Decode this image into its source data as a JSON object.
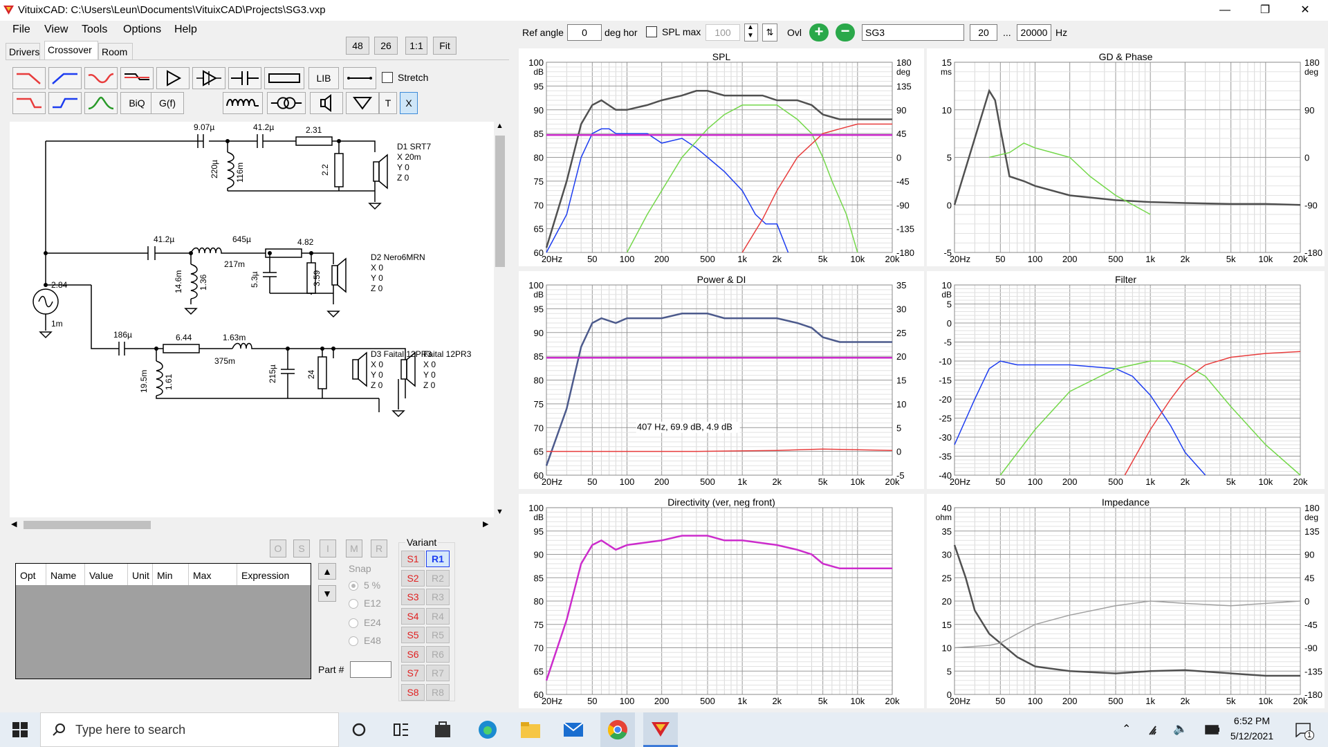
{
  "window": {
    "title": "VituixCAD: C:\\Users\\Leun\\Documents\\VituixCAD\\Projects\\SG3.vxp",
    "minimize": "—",
    "restore": "❐",
    "close": "✕"
  },
  "menu": [
    "File",
    "View",
    "Tools",
    "Options",
    "Help"
  ],
  "tabs": [
    "Drivers",
    "Crossover",
    "Room"
  ],
  "zoom_buttons": [
    "48",
    "26",
    "1:1",
    "Fit"
  ],
  "toolbar": {
    "lib": "LIB",
    "biq": "BiQ",
    "gf": "G(f)",
    "t": "T",
    "x": "X",
    "stretch": "Stretch"
  },
  "topbar": {
    "ref_angle_label": "Ref angle",
    "ref_angle_value": "0",
    "deg_hor": "deg hor",
    "spl_max_label": "SPL max",
    "spl_max_value": "100",
    "ovl": "Ovl",
    "ovl_name": "SG3",
    "f_low": "20",
    "ellipsis": "...",
    "f_high": "20000",
    "hz": "Hz"
  },
  "schematic": {
    "d1": [
      "D1 SRT7",
      "X 20m",
      "Y 0",
      "Z 0"
    ],
    "d2": [
      "D2 Nero6MRN",
      "X 0",
      "Y 0",
      "Z 0"
    ],
    "d3": [
      "D3 Faital 12PR3",
      "X 0",
      "Y 0",
      "Z 0"
    ],
    "d4": [
      "Faital 12PR3",
      "X 0",
      "Y 0",
      "Z 0"
    ],
    "values": {
      "c1": "9.07µ",
      "c2": "41.2µ",
      "r1": "2.31",
      "l1": "220µ",
      "r1s": "116m",
      "r2": "2.2",
      "c3": "41.2µ",
      "l2": "645µ",
      "l2r": "217m",
      "r3": "4.82",
      "l3": "14.6m",
      "l3r": "1.36",
      "c4": "5.3µ",
      "r4": "3.59",
      "src": "2.84",
      "srcr": "1m",
      "c5": "186µ",
      "r5": "6.44",
      "l4": "1.63m",
      "l4r": "375m",
      "l5": "19.5m",
      "l5r": "1.61",
      "c6": "215µ",
      "r6": "24"
    }
  },
  "param_grid": {
    "headers": [
      "Opt",
      "Name",
      "Value",
      "Unit",
      "Min",
      "Max",
      "Expression"
    ]
  },
  "param_buttons": [
    "O",
    "S",
    "I",
    "M",
    "R"
  ],
  "snap": {
    "label": "Snap",
    "options": [
      "5 %",
      "E12",
      "E24",
      "E48"
    ]
  },
  "part_label": "Part #",
  "variant": {
    "label": "Variant",
    "s": [
      "S1",
      "S2",
      "S3",
      "S4",
      "S5",
      "S6",
      "S7",
      "S8"
    ],
    "r": [
      "R1",
      "R2",
      "R3",
      "R4",
      "R5",
      "R6",
      "R7",
      "R8"
    ]
  },
  "colors": {
    "blue": "#1c3cf0",
    "green": "#74d84a",
    "red": "#e83c3c",
    "dark": "#505050",
    "gray": "#a0a0a0",
    "magenta": "#cc2ccc",
    "navy": "#4c5a8c"
  },
  "freq_ticks": [
    "20Hz",
    "50",
    "100",
    "200",
    "500",
    "1k",
    "2k",
    "5k",
    "10k",
    "20k"
  ],
  "charts": {
    "spl": {
      "title": "SPL",
      "yunit": "dB",
      "yunit2": "deg",
      "yticks": [
        "100",
        "95",
        "90",
        "85",
        "80",
        "75",
        "70",
        "65",
        "60"
      ],
      "y2ticks": [
        "180",
        "135",
        "90",
        "45",
        "0",
        "-45",
        "-90",
        "-135",
        "-180"
      ]
    },
    "gd": {
      "title": "GD & Phase",
      "yunit": "ms",
      "yunit2": "deg",
      "yticks": [
        "15",
        "10",
        "5",
        "0",
        "-5"
      ],
      "y2ticks": [
        "180",
        "90",
        "0",
        "-90",
        "-180"
      ]
    },
    "power": {
      "title": "Power & DI",
      "yunit": "dB",
      "yticks": [
        "100",
        "95",
        "90",
        "85",
        "80",
        "75",
        "70",
        "65",
        "60"
      ],
      "y2ticks": [
        "35",
        "30",
        "25",
        "20",
        "15",
        "10",
        "5",
        "0",
        "-5"
      ],
      "readout": "407 Hz, 69.9 dB, 4.9 dB"
    },
    "filter": {
      "title": "Filter",
      "yunit": "dB",
      "yticks": [
        "10",
        "5",
        "0",
        "-5",
        "-10",
        "-15",
        "-20",
        "-25",
        "-30",
        "-35",
        "-40"
      ]
    },
    "directivity": {
      "title": "Directivity (ver, neg front)",
      "yunit": "dB",
      "yticks": [
        "100",
        "95",
        "90",
        "85",
        "80",
        "75",
        "70",
        "65",
        "60"
      ]
    },
    "impedance": {
      "title": "Impedance",
      "yunit": "ohm",
      "yunit2": "deg",
      "yticks": [
        "40",
        "35",
        "30",
        "25",
        "20",
        "15",
        "10",
        "5",
        "0"
      ],
      "y2ticks": [
        "180",
        "135",
        "90",
        "45",
        "0",
        "-45",
        "-90",
        "-135",
        "-180"
      ]
    }
  },
  "chart_data": [
    {
      "type": "line",
      "title": "SPL",
      "xscale": "log",
      "xlim": [
        20,
        20000
      ],
      "ylim": [
        60,
        100
      ],
      "series": [
        {
          "color": "#505050",
          "x": [
            20,
            30,
            40,
            50,
            60,
            80,
            100,
            150,
            200,
            300,
            400,
            500,
            700,
            1000,
            1500,
            2000,
            3000,
            4000,
            5000,
            7000,
            10000,
            15000,
            20000
          ],
          "y": [
            61,
            75,
            87,
            91,
            92,
            90,
            90,
            91,
            92,
            93,
            94,
            94,
            93,
            93,
            93,
            92,
            92,
            91,
            89,
            88,
            88,
            88,
            88
          ]
        },
        {
          "color": "#1c3cf0",
          "x": [
            20,
            30,
            40,
            50,
            60,
            70,
            80,
            100,
            150,
            200,
            300,
            400,
            500,
            700,
            1000,
            1300,
            1600,
            2000,
            2500
          ],
          "y": [
            60,
            68,
            80,
            85,
            86,
            86,
            85,
            85,
            85,
            83,
            84,
            82,
            80,
            77,
            73,
            68,
            66,
            66,
            60
          ]
        },
        {
          "color": "#74d84a",
          "x": [
            100,
            150,
            200,
            300,
            500,
            700,
            1000,
            1500,
            2000,
            3000,
            4000,
            5000,
            6000,
            8000,
            10000
          ],
          "y": [
            60,
            68,
            73,
            80,
            86,
            89,
            91,
            91,
            91,
            88,
            85,
            80,
            75,
            68,
            60
          ]
        },
        {
          "color": "#e83c3c",
          "x": [
            1000,
            1500,
            2000,
            3000,
            5000,
            7000,
            10000,
            15000,
            20000
          ],
          "y": [
            60,
            67,
            73,
            80,
            85,
            86,
            87,
            87,
            87
          ]
        },
        {
          "color": "#cc2ccc",
          "x": [
            20,
            20000
          ],
          "y": [
            84.7,
            84.7
          ]
        }
      ]
    },
    {
      "type": "line",
      "title": "GD & Phase",
      "xscale": "log",
      "xlim": [
        20,
        20000
      ],
      "ylim": [
        -5,
        15
      ],
      "series": [
        {
          "color": "#505050",
          "x": [
            20,
            30,
            40,
            45,
            50,
            60,
            80,
            100,
            200,
            500,
            1000,
            2000,
            5000,
            10000,
            20000
          ],
          "y": [
            0,
            7,
            12,
            11,
            8,
            3,
            2.5,
            2,
            1,
            0.5,
            0.3,
            0.2,
            0.1,
            0.1,
            0
          ]
        },
        {
          "color": "#74d84a",
          "x": [
            40,
            60,
            80,
            100,
            200,
            300,
            500,
            1000
          ],
          "y": [
            5,
            5.5,
            6.5,
            6,
            5,
            3,
            1,
            -1
          ]
        }
      ]
    },
    {
      "type": "line",
      "title": "Power & DI",
      "xscale": "log",
      "xlim": [
        20,
        20000
      ],
      "ylim": [
        60,
        100
      ],
      "series": [
        {
          "color": "#4c5a8c",
          "x": [
            20,
            30,
            40,
            50,
            60,
            80,
            100,
            200,
            300,
            400,
            500,
            700,
            1000,
            2000,
            3000,
            4000,
            5000,
            7000,
            10000,
            15000,
            20000
          ],
          "y": [
            62,
            74,
            87,
            92,
            93,
            92,
            93,
            93,
            94,
            94,
            94,
            93,
            93,
            93,
            92,
            91,
            89,
            88,
            88,
            88,
            88
          ]
        },
        {
          "color": "#e83c3c",
          "x": [
            20,
            407,
            2000,
            5000,
            20000
          ],
          "y": [
            65,
            65,
            65.2,
            65.5,
            65.2
          ]
        },
        {
          "color": "#cc2ccc",
          "x": [
            20,
            20000
          ],
          "y": [
            84.7,
            84.7
          ]
        }
      ]
    },
    {
      "type": "line",
      "title": "Filter",
      "xscale": "log",
      "xlim": [
        20,
        20000
      ],
      "ylim": [
        -40,
        10
      ],
      "series": [
        {
          "color": "#1c3cf0",
          "x": [
            20,
            30,
            40,
            50,
            70,
            100,
            200,
            500,
            700,
            1000,
            1500,
            2000,
            3000
          ],
          "y": [
            -32,
            -20,
            -12,
            -10,
            -11,
            -11,
            -11,
            -12,
            -14,
            -19,
            -27,
            -34,
            -40
          ]
        },
        {
          "color": "#74d84a",
          "x": [
            50,
            100,
            200,
            500,
            1000,
            1500,
            2000,
            3000,
            5000,
            10000,
            20000
          ],
          "y": [
            -40,
            -28,
            -18,
            -12,
            -10,
            -10,
            -11,
            -14,
            -22,
            -32,
            -40
          ]
        },
        {
          "color": "#e83c3c",
          "x": [
            600,
            1000,
            1500,
            2000,
            3000,
            5000,
            10000,
            20000
          ],
          "y": [
            -40,
            -28,
            -20,
            -15,
            -11,
            -9,
            -8,
            -7.5
          ]
        }
      ]
    },
    {
      "type": "line",
      "title": "Directivity (ver, neg front)",
      "xscale": "log",
      "xlim": [
        20,
        20000
      ],
      "ylim": [
        60,
        100
      ],
      "series": [
        {
          "color": "#cc2ccc",
          "x": [
            20,
            30,
            40,
            50,
            60,
            80,
            100,
            200,
            300,
            400,
            500,
            700,
            1000,
            2000,
            3000,
            4000,
            5000,
            7000,
            10000,
            20000
          ],
          "y": [
            63,
            76,
            88,
            92,
            93,
            91,
            92,
            93,
            94,
            94,
            94,
            93,
            93,
            92,
            91,
            90,
            88,
            87,
            87,
            87
          ]
        }
      ]
    },
    {
      "type": "line",
      "title": "Impedance",
      "xscale": "log",
      "xlim": [
        20,
        20000
      ],
      "ylim": [
        0,
        40
      ],
      "series": [
        {
          "color": "#505050",
          "x": [
            20,
            25,
            30,
            40,
            50,
            70,
            100,
            200,
            500,
            1000,
            2000,
            5000,
            10000,
            20000
          ],
          "y": [
            32,
            25,
            18,
            13,
            11,
            8,
            6,
            5,
            4.5,
            5,
            5.2,
            4.5,
            4,
            4
          ]
        },
        {
          "color": "#a0a0a0",
          "x": [
            20,
            40,
            50,
            70,
            100,
            200,
            500,
            1000,
            2000,
            5000,
            10000,
            20000
          ],
          "y": [
            10,
            10.5,
            11,
            13,
            15,
            17,
            19,
            20,
            19.5,
            19,
            19.5,
            20
          ]
        }
      ]
    }
  ],
  "taskbar": {
    "search_placeholder": "Type here to search",
    "time": "6:52 PM",
    "date": "5/12/2021",
    "notif_count": "1"
  }
}
